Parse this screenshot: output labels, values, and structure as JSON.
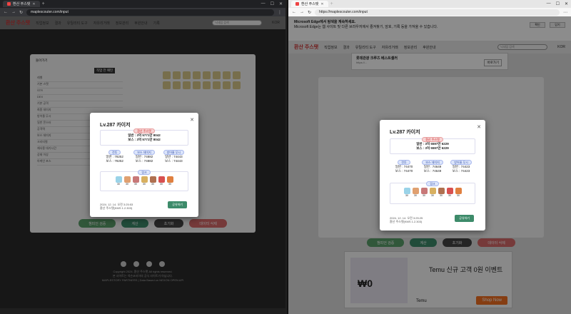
{
  "left": {
    "tab_title": "환산 주스탯",
    "url": "maplescouter.com/input",
    "site": {
      "logo": "환산 주스탯",
      "menu": [
        "직업정보",
        "결과",
        "유틸리티 도구",
        "자유리거래",
        "정보관리",
        "후원안내",
        "기록"
      ],
      "search_placeholder": "닉네임 검색",
      "lang": "KOR"
    },
    "page": {
      "back": "돌아가기",
      "buttons": [
        "직업 전 패턴"
      ],
      "rows": [
        "레벨",
        "기본 스탯",
        "STR",
        "DEX",
        "기본 공격",
        "최종 데미지",
        "방어율 무시",
        "일반 몬스터",
        "공격력",
        "보스 데미지",
        "크리티컬",
        "재사용 대기시간",
        "상태 이상",
        "아케인 포스"
      ],
      "bottom_buttons": [
        "챔피언 검증",
        "계산",
        "초기화",
        "데이터 삭제"
      ]
    },
    "modal": {
      "title": "Lv.287 카이저",
      "section1": "환산 주스탯",
      "line1": "일반 : 3억 5771만 8042",
      "line2": "보스 : 3억 5771만 8042",
      "col_labels": [
        "전투",
        "보스 데미지",
        "방어율 무시"
      ],
      "col_a": [
        "일반 : 78252",
        "보스 : 78252"
      ],
      "col_b": [
        "일반 : 74882",
        "보스 : 74882"
      ],
      "col_c": [
        "일반 : 74443",
        "보스 : 74443"
      ],
      "section2": "링크",
      "icon_nums": [
        "30",
        "30",
        "30",
        "30",
        "30",
        "30",
        "30"
      ],
      "date": "2024. 12. 14. 오전 3:25:53",
      "version": "환산 주스탯(KMS 1.2.303)",
      "share_button": "공유하기"
    },
    "footer": {
      "copyright": "Copyright 2024. 환산 주스탯 All rights reserved.",
      "line2": "본 사이트는 넥슨코리아의 공식 사이트가 아닙니다.",
      "line3": "MAPLESTORY PARTNERS | Data Based on NEXON OPEN API"
    }
  },
  "right": {
    "tab_title": "환산 주스탯",
    "url": "https://maplescouter.com/input",
    "banner": {
      "title": "Microsoft Edge에서 탐색을 계속하세요.",
      "text": "Microsoft Edge는 웹 사이트 및 다른 브라우저에서 즐겨찾기, 암호, 기록 등을 가져올 수 있습니다.",
      "btn_import": "확인",
      "btn_close": "닫기"
    },
    "site": {
      "logo": "환산 주스탯",
      "menu": [
        "직업정보",
        "결과",
        "유틸리티 도구",
        "자유리거래",
        "정보관리",
        "후원안내",
        "기록"
      ],
      "search_placeholder": "닉네임 검색",
      "lang": "KOR"
    },
    "ad_top": {
      "title": "롯데관광 크루즈 베스트셀러",
      "sub": "https://...",
      "btn": "바로가기"
    },
    "modal": {
      "title": "Lv.287 카이저",
      "section1": "환산 주스탯",
      "line1": "일반 : 3억 5597만 6229",
      "line2": "보스 : 3억 5597만 6229",
      "col_labels": [
        "전투",
        "보스 데미지",
        "방어율 무시"
      ],
      "col_a": [
        "일반 : 74470",
        "보스 : 74470"
      ],
      "col_b": [
        "일반 : 74649",
        "보스 : 74649"
      ],
      "col_c": [
        "일반 : 74423",
        "보스 : 74423"
      ],
      "section2": "링크",
      "icon_nums": [
        "30",
        "30",
        "30",
        "30",
        "30",
        "30",
        "30"
      ],
      "date": "2024. 12. 14. 오전 3:25:25",
      "version": "환산 주스탯(KMS 1.2.303)",
      "share_button": "공유하기"
    },
    "bottom_buttons": [
      "챔피언 검증",
      "계산",
      "초기화",
      "데이터 삭제"
    ],
    "ad_bottom": {
      "title": "Temu 신규 고객 0원 이벤트",
      "price": "₩0",
      "brand": "Temu",
      "btn": "Shop Now"
    }
  }
}
